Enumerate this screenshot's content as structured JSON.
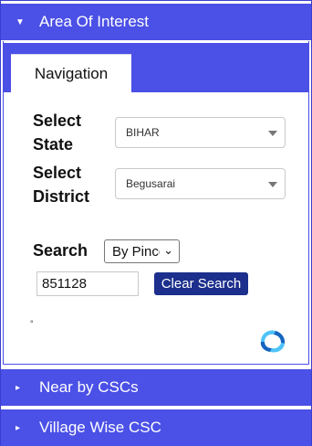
{
  "accordion": {
    "area_of_interest": {
      "label": "Area Of Interest",
      "expanded": true
    },
    "near_by_cscs": {
      "label": "Near by CSCs",
      "expanded": false
    },
    "village_wise_csc": {
      "label": "Village Wise CSC",
      "expanded": false
    }
  },
  "tabs": {
    "navigation": "Navigation"
  },
  "form": {
    "state_label": "Select State",
    "state_value": "BIHAR",
    "district_label": "Select District",
    "district_value": "Begusarai",
    "search_label": "Search",
    "search_mode": "By Pincode",
    "pincode_value": "851128",
    "clear_button": "Clear Search"
  },
  "footer_marker": "°",
  "colors": {
    "header_bg": "#4b50e6",
    "button_bg": "#1c2f8c",
    "spinner_dark": "#1565c0",
    "spinner_light": "#4fc3f7"
  },
  "icons": {
    "expanded": "caret-down-icon",
    "collapsed": "caret-right-icon",
    "loader": "refresh-spinner-icon"
  }
}
